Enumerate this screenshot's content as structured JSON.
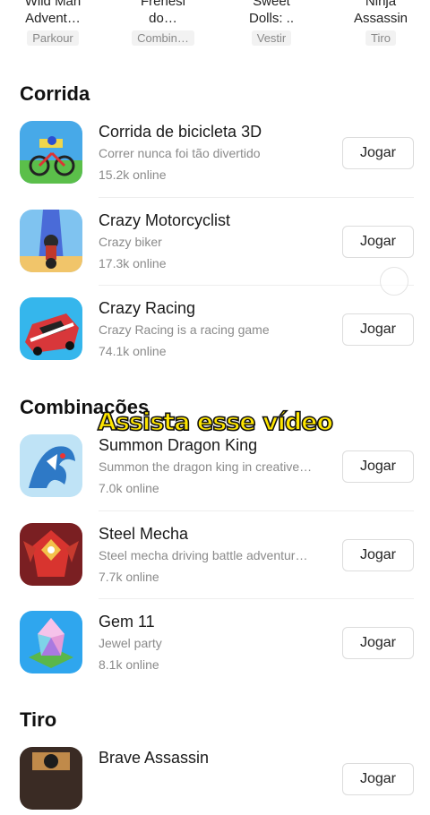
{
  "top_games": [
    {
      "name": "Wild Man\nAdvent…",
      "tag": "Parkour"
    },
    {
      "name": "Frenesi\ndo…",
      "tag": "Combin…"
    },
    {
      "name": "Sweet\nDolls: ..",
      "tag": "Vestir"
    },
    {
      "name": "Ninja\nAssassin",
      "tag": "Tiro"
    }
  ],
  "sections": [
    {
      "title": "Corrida",
      "games": [
        {
          "title": "Corrida de bicicleta 3D",
          "desc": "Correr nunca foi tão divertido",
          "online": "15.2k online",
          "button": "Jogar",
          "icon": "bicycle-icon"
        },
        {
          "title": "Crazy Motorcyclist",
          "desc": "Crazy biker",
          "online": "17.3k online",
          "button": "Jogar",
          "icon": "motorcycle-icon"
        },
        {
          "title": "Crazy Racing",
          "desc": "Crazy Racing is a racing game",
          "online": "74.1k online",
          "button": "Jogar",
          "icon": "race-car-icon"
        }
      ]
    },
    {
      "title": "Combinações",
      "games": [
        {
          "title": "Summon Dragon King",
          "desc": "Summon the dragon king in creative…",
          "online": "7.0k online",
          "button": "Jogar",
          "icon": "dragon-icon"
        },
        {
          "title": "Steel Mecha",
          "desc": "Steel mecha driving battle adventur…",
          "online": "7.7k online",
          "button": "Jogar",
          "icon": "mecha-icon"
        },
        {
          "title": "Gem 11",
          "desc": "Jewel party",
          "online": "8.1k online",
          "button": "Jogar",
          "icon": "gem-icon"
        }
      ]
    },
    {
      "title": "Tiro",
      "games": [
        {
          "title": "Brave Assassin",
          "desc": "",
          "online": "",
          "button": "Jogar",
          "icon": "assassin-icon"
        }
      ]
    }
  ],
  "overlay_caption": "Assista esse vídeo",
  "colors": {
    "caption": "#ffe600",
    "caption_outline": "#111111",
    "tag_bg": "#f2f2f2",
    "divider": "#eeeeee"
  }
}
